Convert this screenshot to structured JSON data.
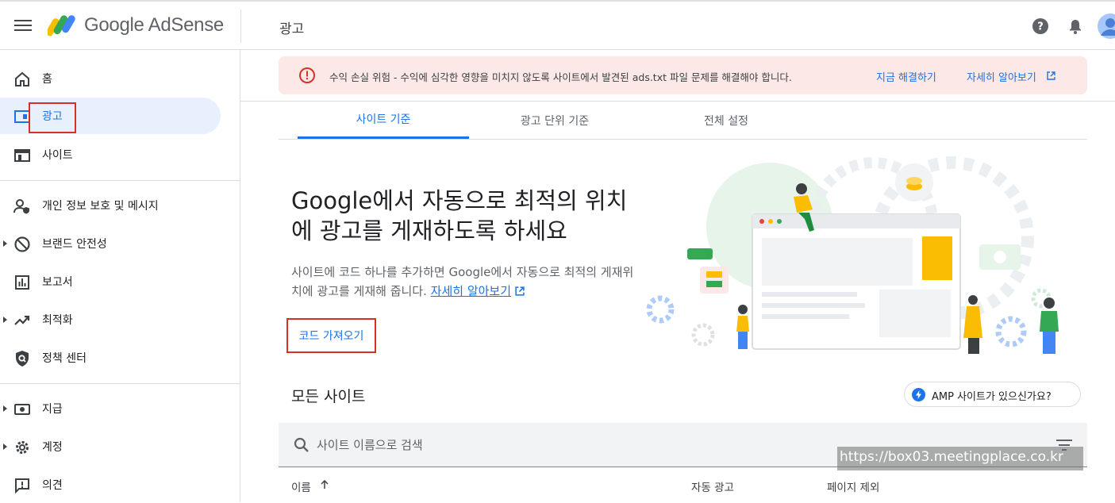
{
  "app": {
    "logo_text": "Google AdSense",
    "page_title": "광고"
  },
  "sidebar": {
    "items": [
      {
        "label": "홈"
      },
      {
        "label": "광고"
      },
      {
        "label": "사이트"
      },
      {
        "label": "개인 정보 보호 및 메시지"
      },
      {
        "label": "브랜드 안전성"
      },
      {
        "label": "보고서"
      },
      {
        "label": "최적화"
      },
      {
        "label": "정책 센터"
      },
      {
        "label": "지급"
      },
      {
        "label": "계정"
      },
      {
        "label": "의견"
      }
    ]
  },
  "alert": {
    "message": "수익 손실 위험 - 수익에 심각한 영향을 미치지 않도록 사이트에서 발견된 ads.txt 파일 문제를 해결해야 합니다.",
    "fix_link": "지금 해결하기",
    "learn_link": "자세히 알아보기"
  },
  "tabs": [
    {
      "label": "사이트 기준"
    },
    {
      "label": "광고 단위 기준"
    },
    {
      "label": "전체 설정"
    }
  ],
  "hero": {
    "title": "Google에서 자동으로 최적의 위치에 광고를 게재하도록 하세요",
    "desc": "사이트에 코드 하나를 추가하면 Google에서 자동으로 최적의 게재위치에 광고를 게재해 줍니다.",
    "learn_link": "자세히 알아보기",
    "get_code": "코드 가져오기"
  },
  "sites": {
    "title": "모든 사이트",
    "amp_chip": "AMP 사이트가 있으신가요?",
    "search_placeholder": "사이트 이름으로 검색",
    "columns": [
      "이름",
      "자동 광고",
      "페이지 제외"
    ]
  },
  "watermark": "https://box03.meetingplace.co.kr",
  "colors": {
    "accent": "#1a73e8",
    "alert_bg": "#fce8e6",
    "error": "#d93025",
    "highlight_box": "#d93025"
  }
}
